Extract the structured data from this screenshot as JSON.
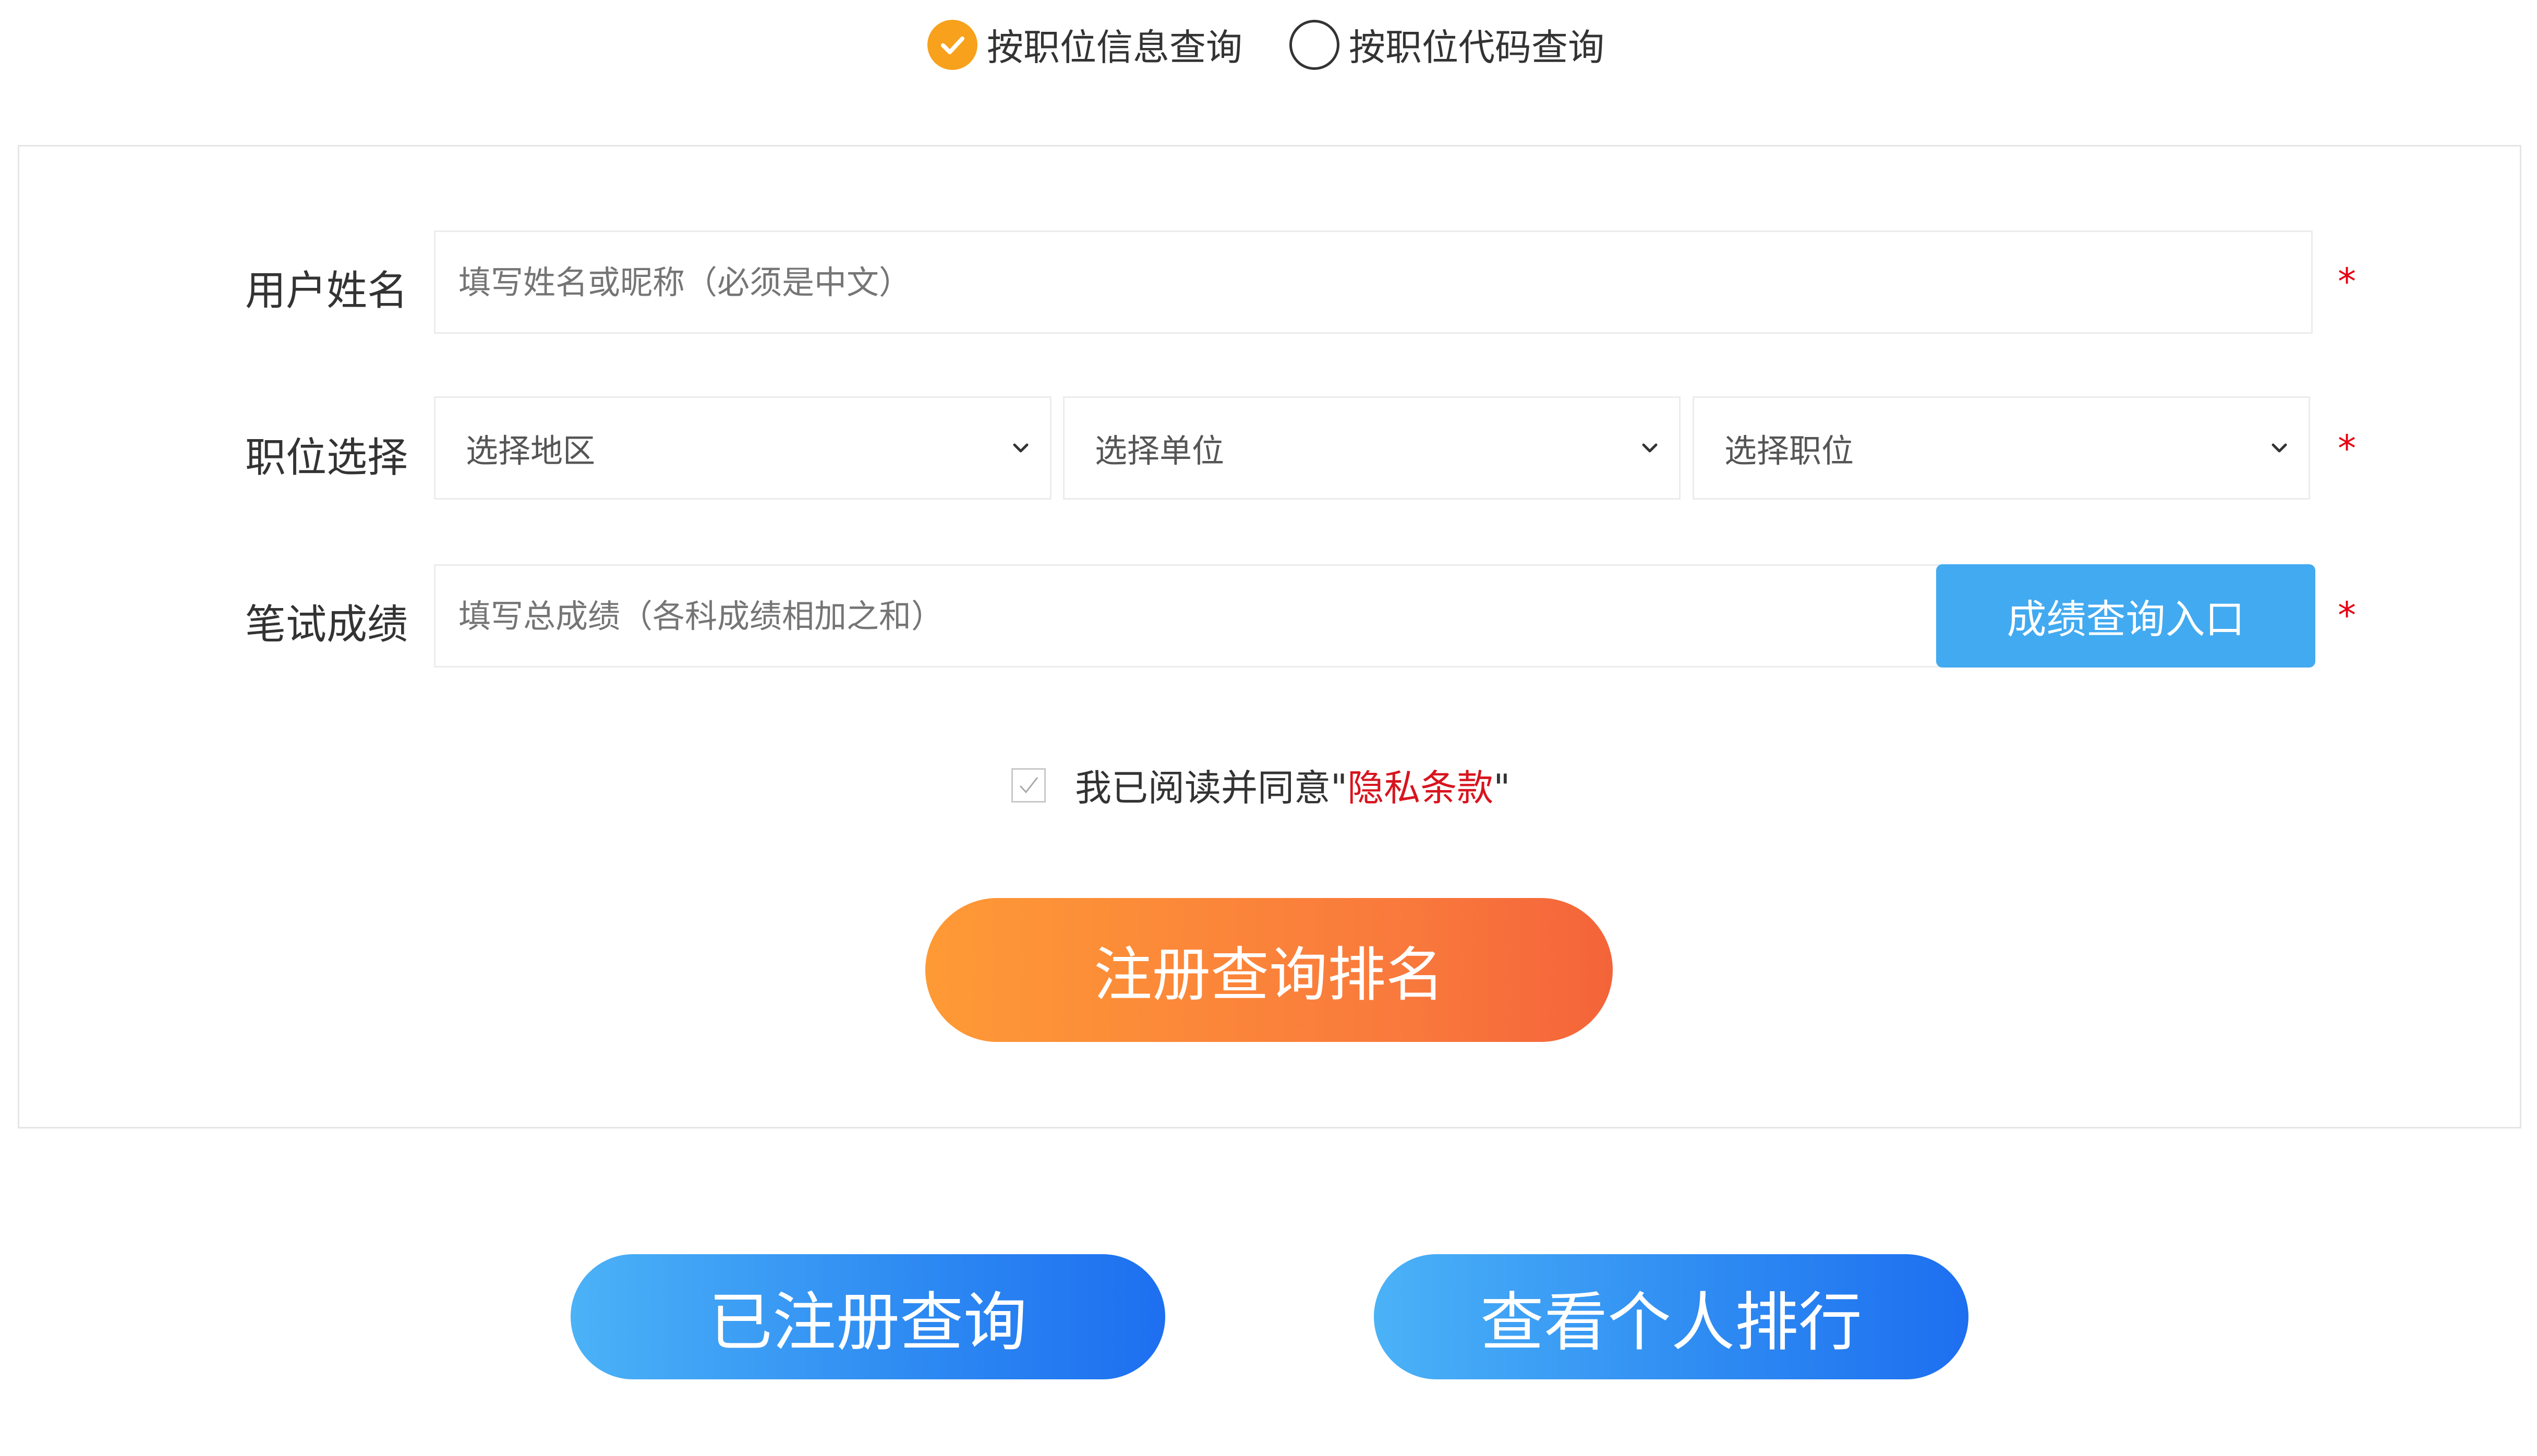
{
  "query_mode": {
    "options": [
      {
        "label": "按职位信息查询",
        "checked": true
      },
      {
        "label": "按职位代码查询",
        "checked": false
      }
    ]
  },
  "form": {
    "name": {
      "label": "用户姓名",
      "placeholder": "填写姓名或昵称（必须是中文）",
      "required_mark": "*"
    },
    "position": {
      "label": "职位选择",
      "region": "选择地区",
      "unit": "选择单位",
      "job": "选择职位",
      "required_mark": "*"
    },
    "score": {
      "label": "笔试成绩",
      "placeholder": "填写总成绩（各科成绩相加之和）",
      "query_button": "成绩查询入口",
      "required_mark": "*"
    },
    "agreement": {
      "checked": true,
      "prefix": "我已阅读并同意\"",
      "link": "隐私条款",
      "suffix": "\""
    },
    "submit": "注册查询排名"
  },
  "footer_buttons": {
    "registered_query": "已注册查询",
    "view_ranking": "查看个人排行"
  },
  "colors": {
    "radio_checked": "#f7a11c",
    "required": "#e60012",
    "link": "#d8141e",
    "query_button": "#42aaf0",
    "submit_gradient": [
      "#fe9a36",
      "#f4643a"
    ],
    "footer_gradient": [
      "#4bb2f7",
      "#1d6ff0"
    ]
  },
  "icons": [
    "checkmark-icon",
    "chevron-down-icon"
  ]
}
